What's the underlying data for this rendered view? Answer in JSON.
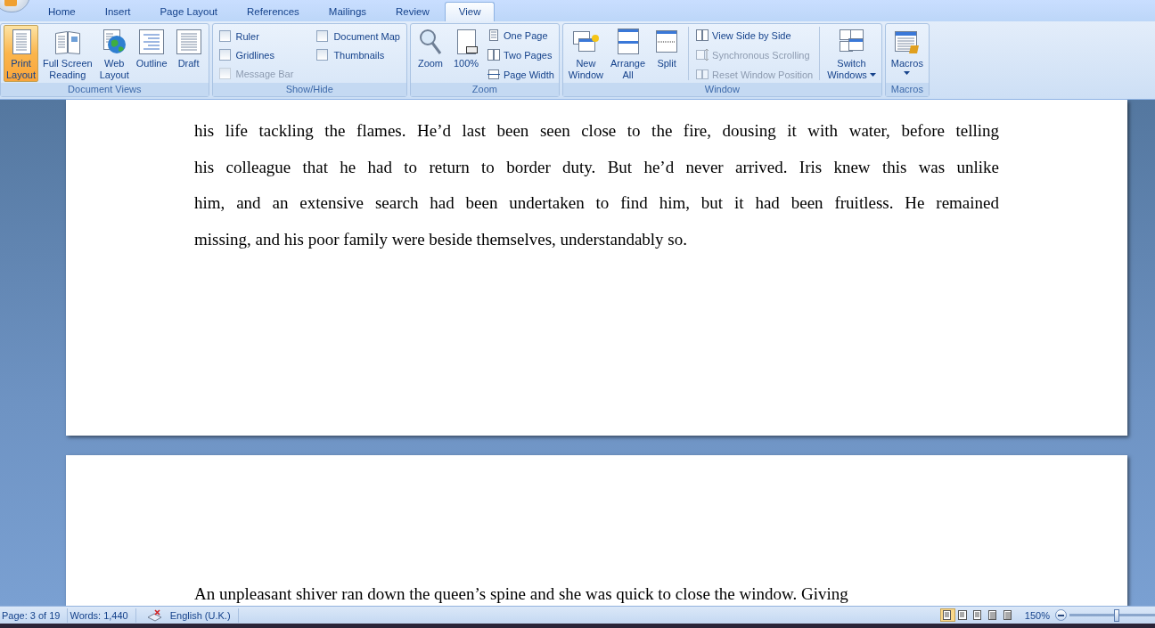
{
  "tabs": [
    {
      "label": "Home",
      "selected": false
    },
    {
      "label": "Insert",
      "selected": false
    },
    {
      "label": "Page Layout",
      "selected": false
    },
    {
      "label": "References",
      "selected": false
    },
    {
      "label": "Mailings",
      "selected": false
    },
    {
      "label": "Review",
      "selected": false
    },
    {
      "label": "View",
      "selected": true
    }
  ],
  "ribbon_groups": [
    {
      "label": "Document Views",
      "items": [
        {
          "kind": "large",
          "lines": [
            "Print",
            "Layout"
          ],
          "selected": true
        },
        {
          "kind": "large",
          "lines": [
            "Full Screen",
            "Reading"
          ],
          "selected": false
        },
        {
          "kind": "large",
          "lines": [
            "Web",
            "Layout"
          ],
          "selected": false
        },
        {
          "kind": "large",
          "lines": [
            "Outline"
          ],
          "selected": false
        },
        {
          "kind": "large",
          "lines": [
            "Draft"
          ],
          "selected": false
        }
      ]
    },
    {
      "label": "Show/Hide",
      "items": [
        {
          "kind": "checkbox",
          "label": "Ruler",
          "checked": false,
          "disabled": false
        },
        {
          "kind": "checkbox",
          "label": "Gridlines",
          "checked": false,
          "disabled": false
        },
        {
          "kind": "checkbox",
          "label": "Message Bar",
          "checked": false,
          "disabled": true
        },
        {
          "kind": "checkbox",
          "label": "Document Map",
          "checked": false,
          "disabled": false
        },
        {
          "kind": "checkbox",
          "label": "Thumbnails",
          "checked": false,
          "disabled": false
        }
      ]
    },
    {
      "label": "Zoom",
      "items": [
        {
          "kind": "large",
          "lines": [
            "Zoom"
          ],
          "dropdown": false
        },
        {
          "kind": "large",
          "lines": [
            "100%"
          ],
          "dropdown": false
        },
        {
          "kind": "small",
          "label": "One Page",
          "disabled": false
        },
        {
          "kind": "small",
          "label": "Two Pages",
          "disabled": false
        },
        {
          "kind": "small",
          "label": "Page Width",
          "disabled": false
        }
      ]
    },
    {
      "label": "Window",
      "items": [
        {
          "kind": "large",
          "lines": [
            "New",
            "Window"
          ],
          "dropdown": false
        },
        {
          "kind": "large",
          "lines": [
            "Arrange",
            "All"
          ],
          "dropdown": false
        },
        {
          "kind": "large",
          "lines": [
            "Split"
          ],
          "dropdown": false
        },
        {
          "kind": "separator"
        },
        {
          "kind": "small",
          "label": "View Side by Side",
          "disabled": false
        },
        {
          "kind": "small",
          "label": "Synchronous Scrolling",
          "disabled": true
        },
        {
          "kind": "small",
          "label": "Reset Window Position",
          "disabled": true
        },
        {
          "kind": "separator"
        },
        {
          "kind": "large",
          "lines": [
            "Switch",
            "Windows"
          ],
          "dropdown": true
        }
      ]
    },
    {
      "label": "Macros",
      "items": [
        {
          "kind": "large",
          "lines": [
            "Macros"
          ],
          "dropdown": true
        }
      ]
    }
  ],
  "pages": [
    {
      "lines": [
        "his life tackling the flames. He’d last been seen close to the fire, dousing it with water, before telling",
        "his colleague that he had to return to border duty. But he’d never arrived. Iris knew this was unlike",
        "him, and an extensive search had been undertaken to find him, but it had been fruitless. He remained",
        "missing, and his poor family were beside themselves, understandably so."
      ]
    },
    {
      "lines": [
        "An unpleasant shiver ran down the queen’s spine and she was quick to close the window. Giving"
      ]
    }
  ],
  "status_bar": {
    "page": "Page: 3 of 19",
    "words": "Words: 1,440",
    "language": "English (U.K.)",
    "view_buttons": [
      {
        "selected": true
      },
      {
        "selected": false
      },
      {
        "selected": false
      },
      {
        "selected": false
      },
      {
        "selected": false
      }
    ],
    "zoom": "150%",
    "zoom_slider": {
      "level": 0.55
    }
  }
}
